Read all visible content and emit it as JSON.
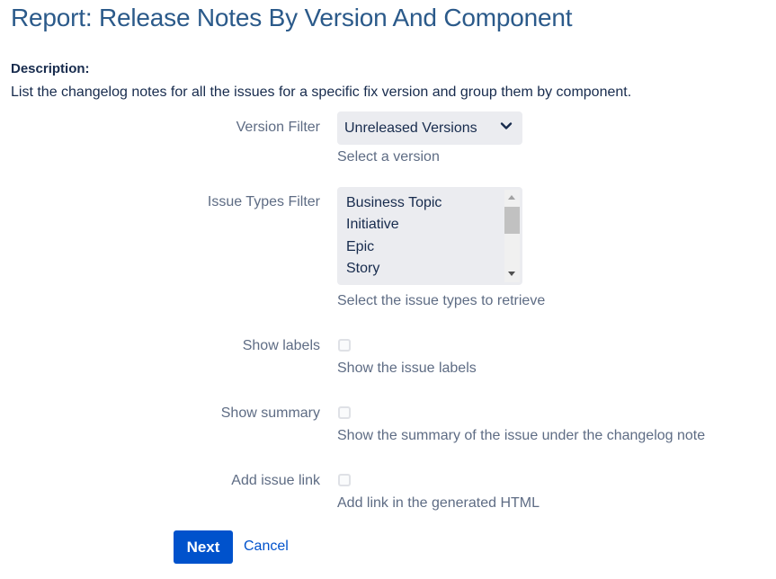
{
  "page": {
    "title": "Report: Release Notes By Version And Component",
    "description_heading": "Description:",
    "description_text": "List the changelog notes for all the issues for a specific fix version and group them by component."
  },
  "form": {
    "version_filter": {
      "label": "Version Filter",
      "selected": "Unreleased Versions",
      "help": "Select a version"
    },
    "issue_types_filter": {
      "label": "Issue Types Filter",
      "options": [
        "Business Topic",
        "Initiative",
        "Epic",
        "Story"
      ],
      "help": "Select the issue types to retrieve"
    },
    "show_labels": {
      "label": "Show labels",
      "checked": false,
      "help": "Show the issue labels"
    },
    "show_summary": {
      "label": "Show summary",
      "checked": false,
      "help": "Show the summary of the issue under the changelog note"
    },
    "add_issue_link": {
      "label": "Add issue link",
      "checked": false,
      "help": "Add link in the generated HTML"
    }
  },
  "actions": {
    "next_label": "Next",
    "cancel_label": "Cancel"
  },
  "icons": {
    "select_chevron": "chevron-down-icon",
    "scroll_up": "scroll-up-arrow-icon",
    "scroll_down": "scroll-down-arrow-icon"
  },
  "colors": {
    "title": "#2b5a8a",
    "primary_button": "#0052cc",
    "field_background": "#ebecf0",
    "label_text": "#5e6c84",
    "body_text": "#172b4d"
  }
}
